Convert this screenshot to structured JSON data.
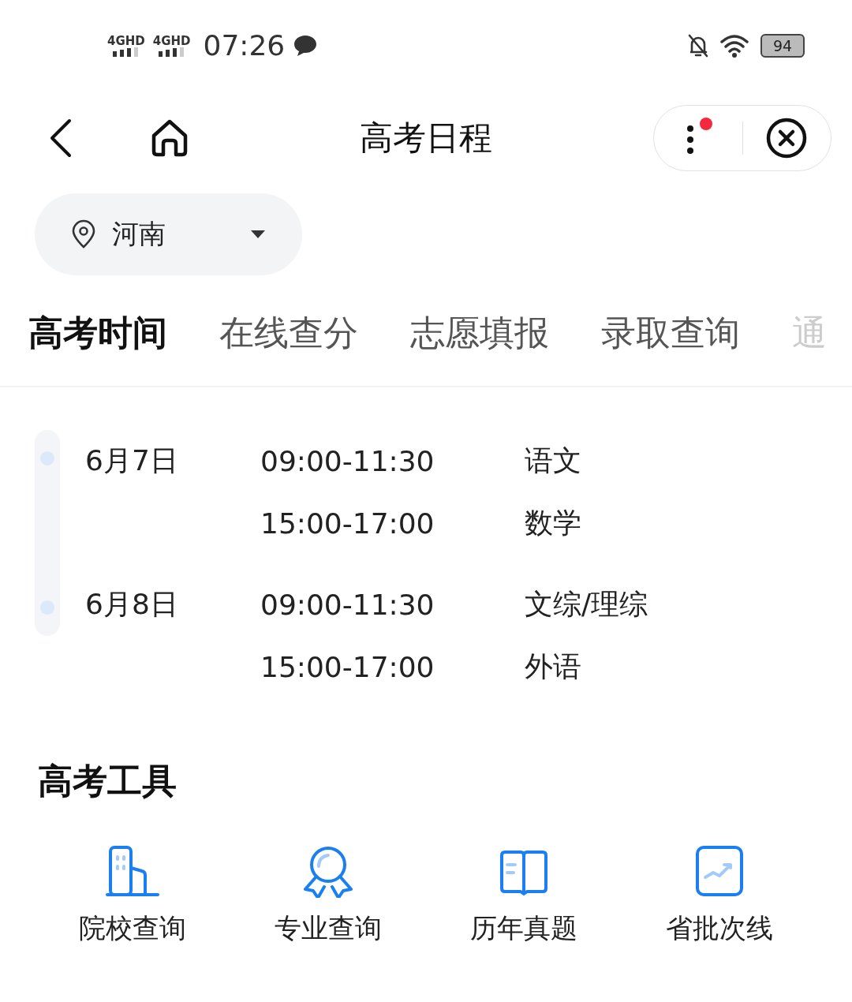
{
  "status_bar": {
    "signals": [
      "4GHD",
      "4GHD"
    ],
    "time": "07:26",
    "battery": "94"
  },
  "nav": {
    "title": "高考日程",
    "menu_badge": true
  },
  "location": {
    "value": "河南"
  },
  "tabs": [
    {
      "label": "高考时间",
      "selected": true
    },
    {
      "label": "在线查分",
      "selected": false
    },
    {
      "label": "志愿填报",
      "selected": false
    },
    {
      "label": "录取查询",
      "selected": false
    },
    {
      "label": "通",
      "selected": false,
      "faded": true
    }
  ],
  "schedule": [
    {
      "date": "6月7日",
      "sessions": [
        {
          "time": "09:00-11:30",
          "subject": "语文"
        },
        {
          "time": "15:00-17:00",
          "subject": "数学"
        }
      ]
    },
    {
      "date": "6月8日",
      "sessions": [
        {
          "time": "09:00-11:30",
          "subject": "文综/理综"
        },
        {
          "time": "15:00-17:00",
          "subject": "外语"
        }
      ]
    }
  ],
  "tools": {
    "title": "高考工具",
    "items": [
      {
        "kind": "building",
        "label": "院校查询"
      },
      {
        "kind": "medal",
        "label": "专业查询"
      },
      {
        "kind": "book",
        "label": "历年真题"
      },
      {
        "kind": "chart",
        "label": "省批次线"
      }
    ]
  }
}
